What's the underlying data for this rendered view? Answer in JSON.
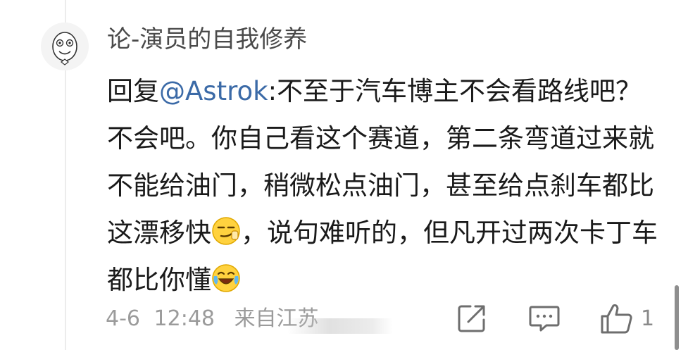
{
  "comment": {
    "username": "论-演员的自我修养",
    "reply_prefix": "回复",
    "mention": "@Astrok",
    "text_part1": ":不至于汽车博主不会看路线吧？不会吧。你自己看这个赛道，第二条弯道过来就不能给油门，稍微松点油门，甚至给点刹车都比这漂移快",
    "emoji1": "smirk-emoji",
    "text_part2": "，说句难听的，但凡开过两次卡丁车都比你懂",
    "emoji2": "laughing-crying-emoji"
  },
  "meta": {
    "date": "4-6",
    "time": "12:48",
    "source": "来自江苏"
  },
  "actions": {
    "share_icon": "share-icon",
    "comment_icon": "comment-icon",
    "like_icon": "thumbs-up-icon",
    "like_count": "1"
  },
  "colors": {
    "mention": "#3b6aa7",
    "text": "#1a1a1a",
    "meta": "#9b9b9b"
  }
}
